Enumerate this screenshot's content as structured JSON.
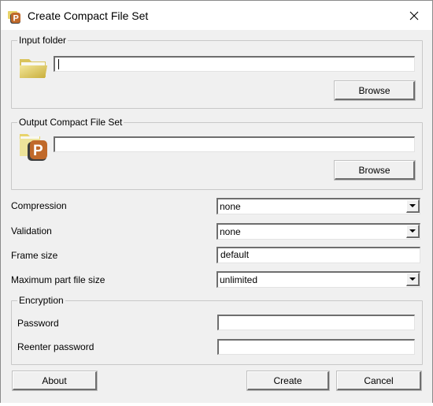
{
  "window": {
    "title": "Create Compact File Set",
    "close_icon": "close-icon",
    "app_icon": "compact-file-set-icon"
  },
  "input_folder": {
    "legend": "Input folder",
    "icon": "folder-icon",
    "value": "",
    "browse_label": "Browse"
  },
  "output": {
    "legend": "Output Compact File Set",
    "icon": "compact-file-set-folder-icon",
    "value": "",
    "browse_label": "Browse"
  },
  "options": {
    "compression": {
      "label": "Compression",
      "value": "none"
    },
    "validation": {
      "label": "Validation",
      "value": "none"
    },
    "frame_size": {
      "label": "Frame size",
      "value": "default"
    },
    "max_part": {
      "label": "Maximum part file size",
      "value": "unlimited"
    }
  },
  "encryption": {
    "legend": "Encryption",
    "password_label": "Password",
    "password_value": "",
    "reenter_label": "Reenter password",
    "reenter_value": ""
  },
  "buttons": {
    "about": "About",
    "create": "Create",
    "cancel": "Cancel"
  },
  "colors": {
    "brand_orange": "#c0692a",
    "folder_yellow": "#e8d36a"
  }
}
